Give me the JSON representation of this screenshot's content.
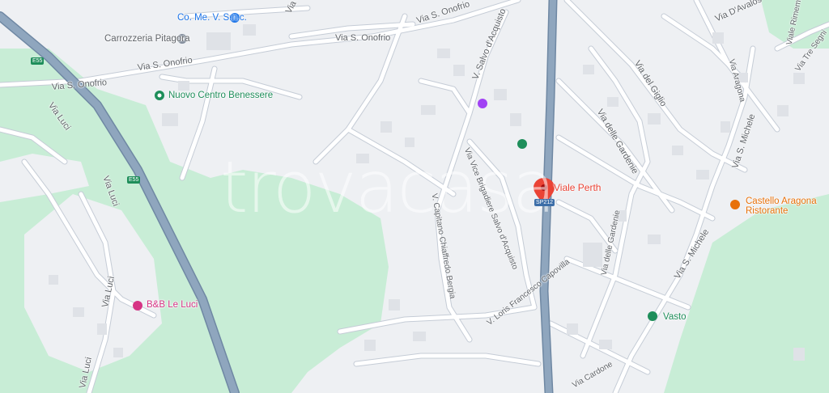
{
  "map": {
    "watermark": "trovacasa",
    "roads": {
      "via_s_onofrio_1": "Via S. Onofrio",
      "via_s_onofrio_2": "Via S. Onofrio",
      "via_s_onofrio_3": "Via S. Onofrio",
      "via_salvo_dacquisto": "V. Salvo d'Acquisto",
      "via_olivi": "Via Olivi",
      "via_davalos": "Via D'Avalos",
      "viale_rimembranze": "Viale Rimembr...",
      "via_tre_segni": "Via Tre Segni",
      "via_aragona": "Via Aragona",
      "via_del_giglio": "Via del Giglio",
      "via_delle_gardenie_1": "Via delle Gardenie",
      "via_delle_gardenie_2": "Via delle Gardenie",
      "via_s_michele_1": "Via S. Michele",
      "via_s_michele_2": "Via S. Michele",
      "via_luci_1": "Via Luci",
      "via_luci_2": "Via Luci",
      "via_luci_3": "Via Luci",
      "via_luci_4": "Via Luci",
      "v_brigadiere": "Via Vice Brigadiere Salvo d'Acquisto",
      "v_capitano": "V. Capitano Chiaffredo Bergia",
      "v_loris": "V. Loris Francesco Capovilla",
      "via_cardone": "Via Cardone"
    },
    "shields": {
      "e55_top": "E55",
      "e55_mid": "E55",
      "sp212": "SP212"
    },
    "pois": {
      "come_vs": "Co. Me. V. S.n.c.",
      "carrozzeria": "Carrozzeria Pitagora",
      "nuovo_centro": "Nuovo Centro Benessere",
      "bb_le_luci": "B&B Le Luci",
      "castello_line1": "Castello Aragona",
      "castello_line2": "Ristorante",
      "vasto": "Vasto",
      "viale_perth": "Viale Perth"
    },
    "colors": {
      "background": "#eef0f3",
      "park": "#c8edd6",
      "road": "#ffffff",
      "road_outline": "#c5ccd6",
      "highway": "#8fa6be",
      "pin": "#ea4335",
      "poi_green": "#1e8e5a",
      "poi_pink": "#d63384",
      "poi_orange": "#e8710a",
      "poi_blue": "#1a73e8"
    }
  }
}
